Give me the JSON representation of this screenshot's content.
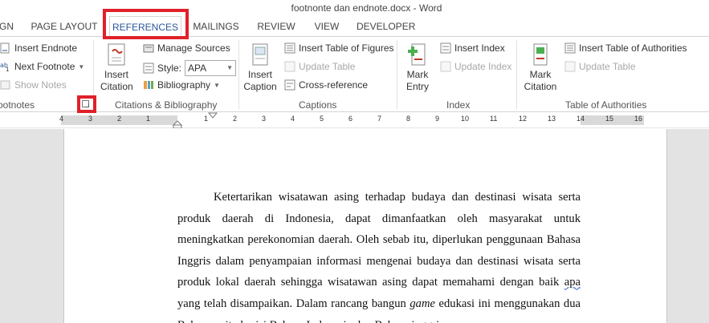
{
  "window": {
    "title": "footnonte dan endnote.docx - Word"
  },
  "tabs": [
    {
      "label": "GN"
    },
    {
      "label": "PAGE LAYOUT"
    },
    {
      "label": "REFERENCES",
      "active": true
    },
    {
      "label": "MAILINGS"
    },
    {
      "label": "REVIEW"
    },
    {
      "label": "VIEW"
    },
    {
      "label": "DEVELOPER"
    }
  ],
  "ribbon": {
    "footnotes": {
      "insert_endnote": "Insert Endnote",
      "next_footnote": "Next Footnote",
      "show_notes": "Show Notes",
      "group_label": "ootnotes"
    },
    "citations": {
      "insert_citation": "Insert Citation",
      "manage_sources": "Manage Sources",
      "style_label": "Style:",
      "style_value": "APA",
      "bibliography": "Bibliography",
      "group_label": "Citations & Bibliography"
    },
    "captions": {
      "insert_caption": "Insert Caption",
      "insert_table_of_figures": "Insert Table of Figures",
      "update_table": "Update Table",
      "cross_reference": "Cross-reference",
      "group_label": "Captions"
    },
    "index": {
      "mark_entry": "Mark Entry",
      "insert_index": "Insert Index",
      "update_index": "Update Index",
      "group_label": "Index"
    },
    "authorities": {
      "mark_citation": "Mark Citation",
      "insert_table_of_authorities": "Insert Table of Authorities",
      "update_table": "Update Table",
      "group_label": "Table of Authorities"
    }
  },
  "ruler": {
    "labels": [
      "4",
      "3",
      "2",
      "1",
      "1",
      "2",
      "3",
      "4",
      "5",
      "6",
      "7",
      "8",
      "9",
      "10",
      "11",
      "12",
      "13",
      "14",
      "15",
      "16"
    ]
  },
  "document": {
    "p1_a": "Ketertarikan wisatawan asing terhadap budaya dan destinasi wisata serta produk daerah di Indonesia, dapat dimanfaatkan oleh masyarakat untuk meningkatkan perekonomian daerah. Oleh sebab itu, diperlukan penggunaan Bahasa Inggris dalam penyampaian informasi mengenai budaya dan destinasi wisata serta produk lokal daerah sehingga wisatawan asing dapat memahami dengan baik ",
    "p1_sq": "apa",
    "p1_b": " yang telah disampaikan. Dalam rancang bangun ",
    "p1_italic": "game",
    "p1_c": " edukasi ini menggunakan dua Bahasa yaitu berisi Bahasa Indonesia dan Bahasa inggris."
  },
  "colors": {
    "accent": "#2b579a",
    "highlight": "#e0202a"
  }
}
